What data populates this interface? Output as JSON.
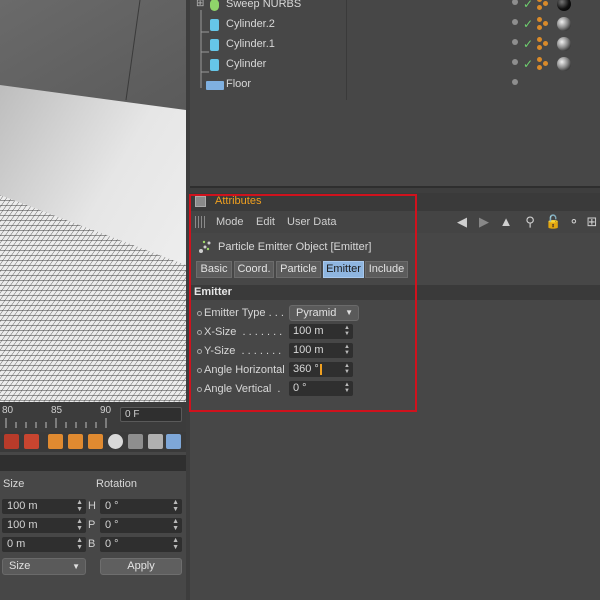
{
  "objects": [
    {
      "name": "Sweep NURBS"
    },
    {
      "name": "Cylinder.2"
    },
    {
      "name": "Cylinder.1"
    },
    {
      "name": "Cylinder"
    },
    {
      "name": "Floor"
    }
  ],
  "attributes": {
    "title": "Attributes",
    "menu": [
      "Mode",
      "Edit",
      "User Data"
    ],
    "object_title": "Particle Emitter Object [Emitter]",
    "tabs": [
      "Basic",
      "Coord.",
      "Particle",
      "Emitter",
      "Include"
    ],
    "active_tab": "Emitter",
    "section": "Emitter",
    "params": [
      {
        "label": "Emitter Type . . .",
        "value": "Pyramid",
        "kind": "dropdown"
      },
      {
        "label": "X-Size  . . . . . . .",
        "value": "100 m",
        "kind": "number"
      },
      {
        "label": "Y-Size  . . . . . . .",
        "value": "100 m",
        "kind": "number"
      },
      {
        "label": "Angle Horizontal",
        "value": "360 °",
        "kind": "number"
      },
      {
        "label": "Angle Vertical  .",
        "value": "0 °",
        "kind": "number"
      }
    ]
  },
  "timeline": {
    "labels": [
      "80",
      "85",
      "90"
    ],
    "frame": "0 F"
  },
  "coordinates": {
    "headers": {
      "size": "Size",
      "rotation": "Rotation"
    },
    "size_values": [
      "100 m",
      "100 m",
      "0 m"
    ],
    "rotation_axes": [
      "H",
      "P",
      "B"
    ],
    "rotation_values": [
      "0 °",
      "0 °",
      "0 °"
    ],
    "mode_dropdown": "Size",
    "apply_label": "Apply"
  },
  "colors": {
    "title_accent": "#f0a020",
    "highlight": "#d0121d",
    "active_tab": "#8fb6e0"
  }
}
